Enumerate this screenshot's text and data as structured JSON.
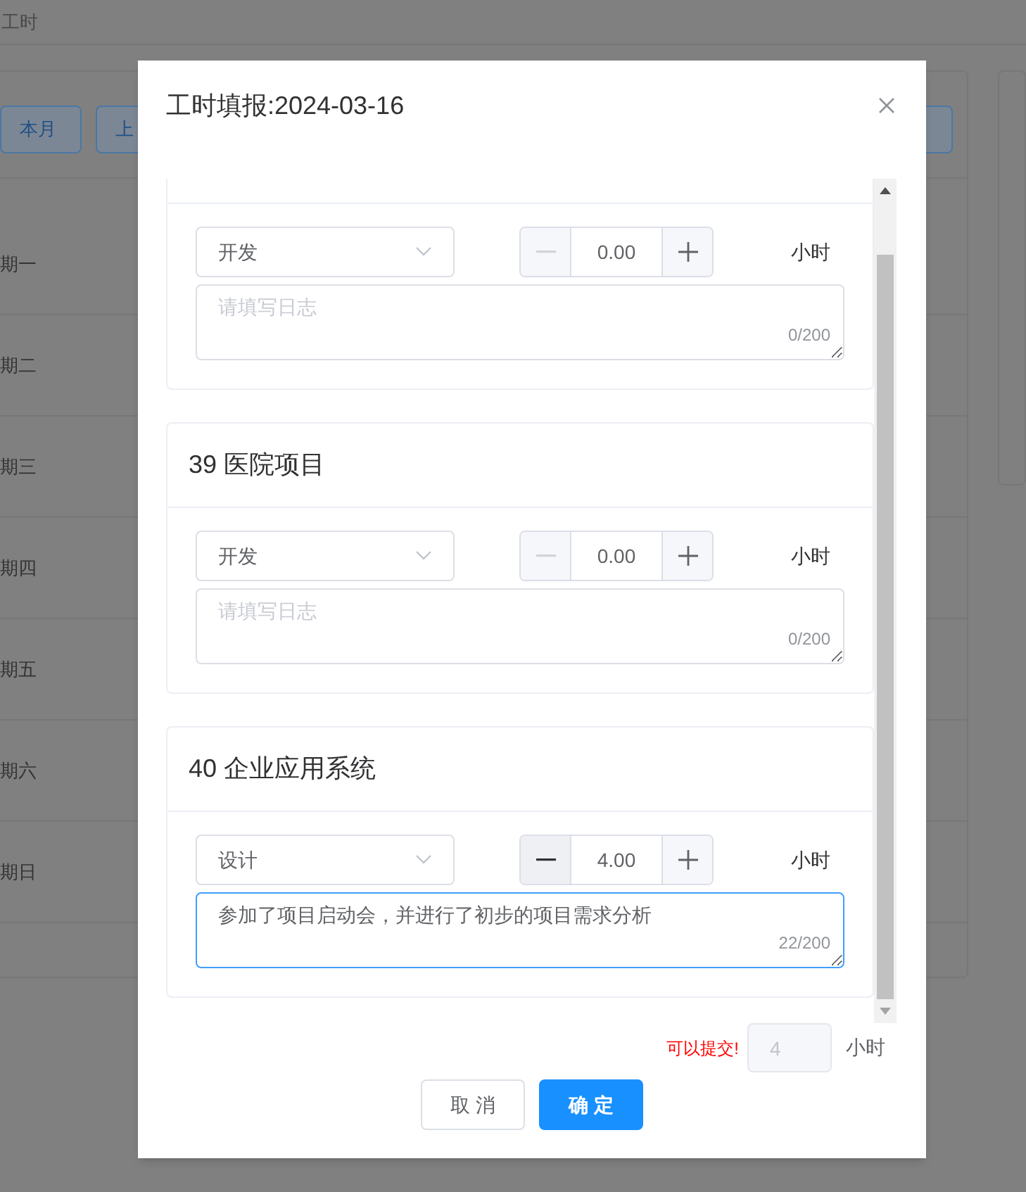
{
  "background": {
    "title": "工时",
    "buttons": [
      {
        "label": "本月"
      },
      {
        "label": "上"
      }
    ],
    "days": [
      "期一",
      "期二",
      "期三",
      "期四",
      "期五",
      "期六",
      "期日"
    ]
  },
  "dialog": {
    "title": "工时填报:2024-03-16",
    "entries": [
      {
        "category": "开发",
        "hours": "0.00",
        "minus_disabled": true,
        "unit": "小时",
        "log_placeholder": "请填写日志",
        "count": "0/200",
        "focused": false
      },
      {
        "project": "39 医院项目",
        "category": "开发",
        "hours": "0.00",
        "minus_disabled": true,
        "unit": "小时",
        "log_placeholder": "请填写日志",
        "count": "0/200",
        "focused": false
      },
      {
        "project": "40 企业应用系统",
        "category": "设计",
        "hours": "4.00",
        "minus_disabled": false,
        "unit": "小时",
        "log": "参加了项目启动会，并进行了初步的项目需求分析",
        "count": "22/200",
        "focused": true
      }
    ],
    "footer": {
      "status": "可以提交!",
      "total": "4",
      "unit": "小时"
    },
    "buttons": [
      {
        "kind": "cancel",
        "label": "取 消"
      },
      {
        "kind": "confirm",
        "label": "确 定"
      }
    ]
  }
}
